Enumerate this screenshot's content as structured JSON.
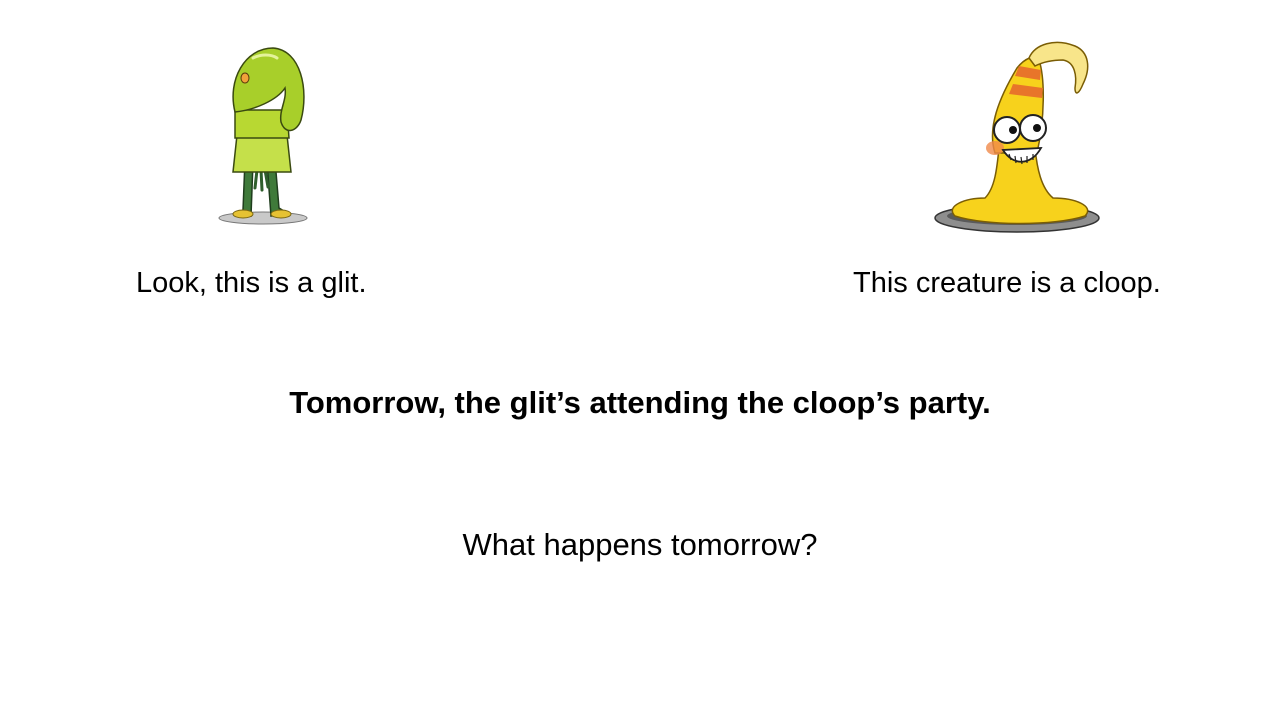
{
  "slide": {
    "left_caption": "Look, this is a glit.",
    "right_caption": "This creature is a cloop.",
    "statement": "Tomorrow, the glit’s attending the cloop’s party.",
    "question": "What happens tomorrow?",
    "left_illustration": "glit-creature-icon",
    "right_illustration": "cloop-creature-icon"
  },
  "colors": {
    "background": "#ffffff",
    "text": "#000000",
    "glit_body": "#b8d832",
    "glit_legs": "#3f7a3a",
    "cloop_body": "#f7d21c",
    "cloop_stripes": "#e8752a"
  }
}
